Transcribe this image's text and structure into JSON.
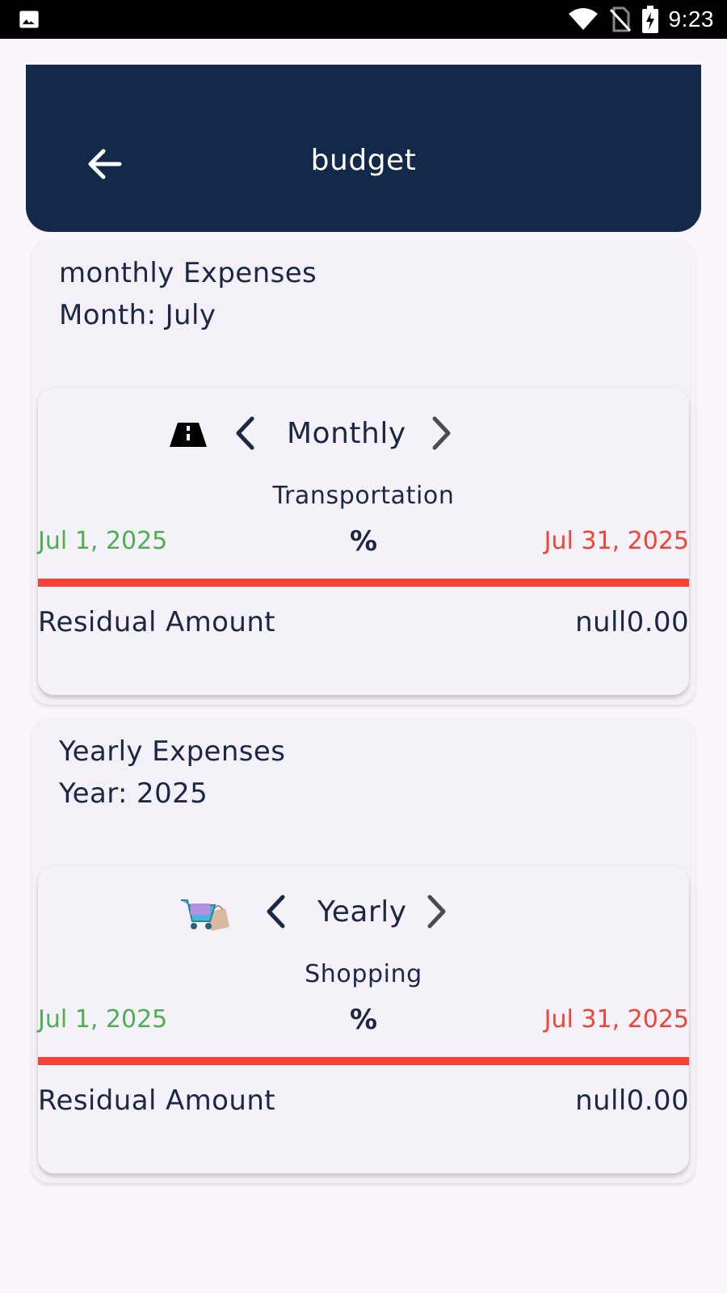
{
  "status_bar": {
    "time": "9:23",
    "icons": [
      "image-icon",
      "wifi-icon",
      "no-sim-icon",
      "battery-charging-icon"
    ]
  },
  "app_bar": {
    "title": "budget",
    "back_icon": "arrow-left-icon"
  },
  "monthly": {
    "title": "monthly Expenses",
    "subtitle": "Month: July",
    "card": {
      "icon": "road-icon",
      "period": "Monthly",
      "category": "Transportation",
      "start_date": "Jul 1, 2025",
      "end_date": "Jul 31, 2025",
      "percent": "%",
      "progress": 1.0,
      "residual_label": "Residual Amount",
      "residual_value": "null0.00"
    }
  },
  "yearly": {
    "title": "Yearly Expenses",
    "subtitle": "Year: 2025",
    "card": {
      "icon": "shopping-cart-icon",
      "period": "Yearly",
      "category": "Shopping",
      "start_date": "Jul 1, 2025",
      "end_date": "Jul 31, 2025",
      "percent": "%",
      "progress": 1.0,
      "residual_label": "Residual Amount",
      "residual_value": "null0.00"
    }
  },
  "colors": {
    "app_bar": "#12294a",
    "start_date": "#4caf50",
    "end_date": "#f44336",
    "progress": "#f44336",
    "text": "#1c2745"
  }
}
